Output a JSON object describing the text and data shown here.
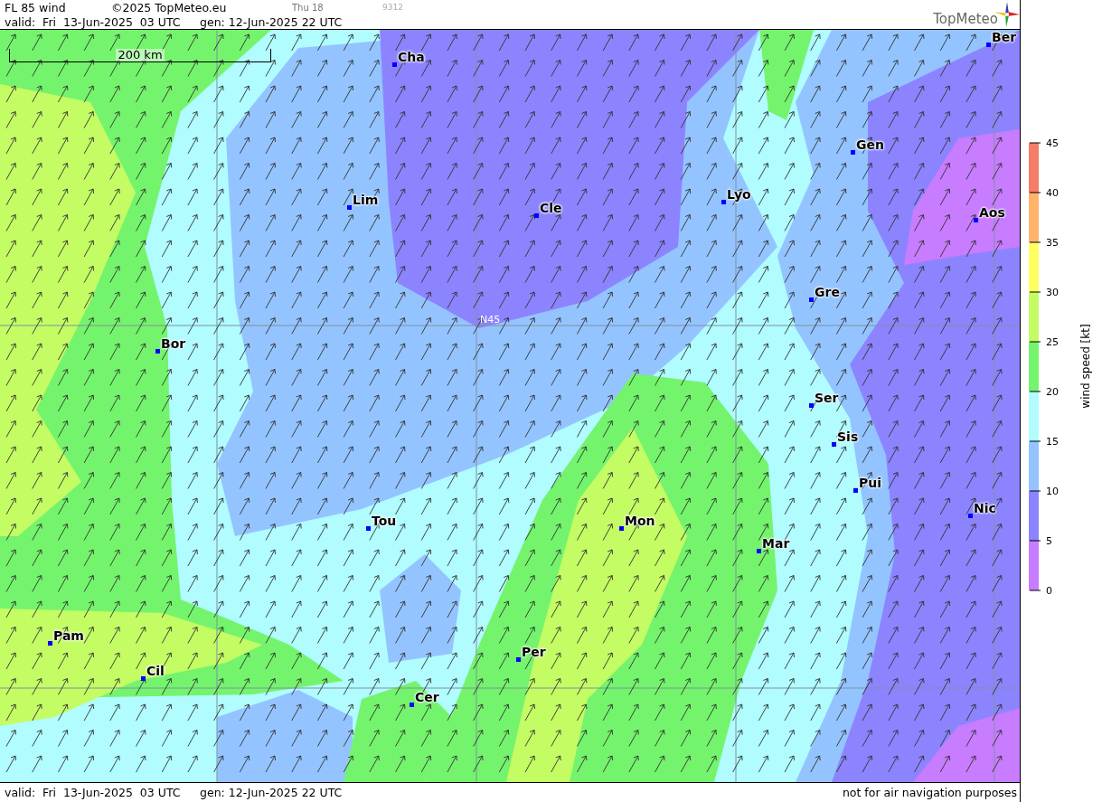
{
  "header": {
    "title": "FL 85 wind",
    "copyright": "©2025 TopMeteo.eu",
    "day": "Thu 18",
    "code": "9312",
    "valid": "valid:  Fri  13-Jun-2025  03 UTC",
    "gen": "gen: 12-Jun-2025 22 UTC",
    "logo": "TopMeteo"
  },
  "map": {
    "scale": "200 km",
    "latitude_label": "N45",
    "cities": [
      {
        "name": "Cha"
      },
      {
        "name": "Ber"
      },
      {
        "name": "Gen"
      },
      {
        "name": "Lim"
      },
      {
        "name": "Cle"
      },
      {
        "name": "Lyo"
      },
      {
        "name": "Aos"
      },
      {
        "name": "Gre"
      },
      {
        "name": "Bor"
      },
      {
        "name": "Ser"
      },
      {
        "name": "Sis"
      },
      {
        "name": "Pui"
      },
      {
        "name": "Tou"
      },
      {
        "name": "Mon"
      },
      {
        "name": "Nic"
      },
      {
        "name": "Mar"
      },
      {
        "name": "Pam"
      },
      {
        "name": "Cil"
      },
      {
        "name": "Per"
      },
      {
        "name": "Cer"
      }
    ]
  },
  "legend": {
    "title": "wind speed [kt]",
    "ticks": [
      "45",
      "40",
      "35",
      "30",
      "25",
      "20",
      "15",
      "10",
      "5",
      "0"
    ],
    "bins": [
      {
        "color": "#f47c68"
      },
      {
        "color": "#ffb46c"
      },
      {
        "color": "#ffff64"
      },
      {
        "color": "#c4fc64"
      },
      {
        "color": "#74f46c"
      },
      {
        "color": "#b0fcff"
      },
      {
        "color": "#94c4ff"
      },
      {
        "color": "#8c84ff"
      },
      {
        "color": "#c87cff"
      }
    ]
  },
  "footer": {
    "valid": "valid:  Fri  13-Jun-2025  03 UTC",
    "gen": "gen: 12-Jun-2025 22 UTC",
    "note": "not for air navigation purposes"
  }
}
